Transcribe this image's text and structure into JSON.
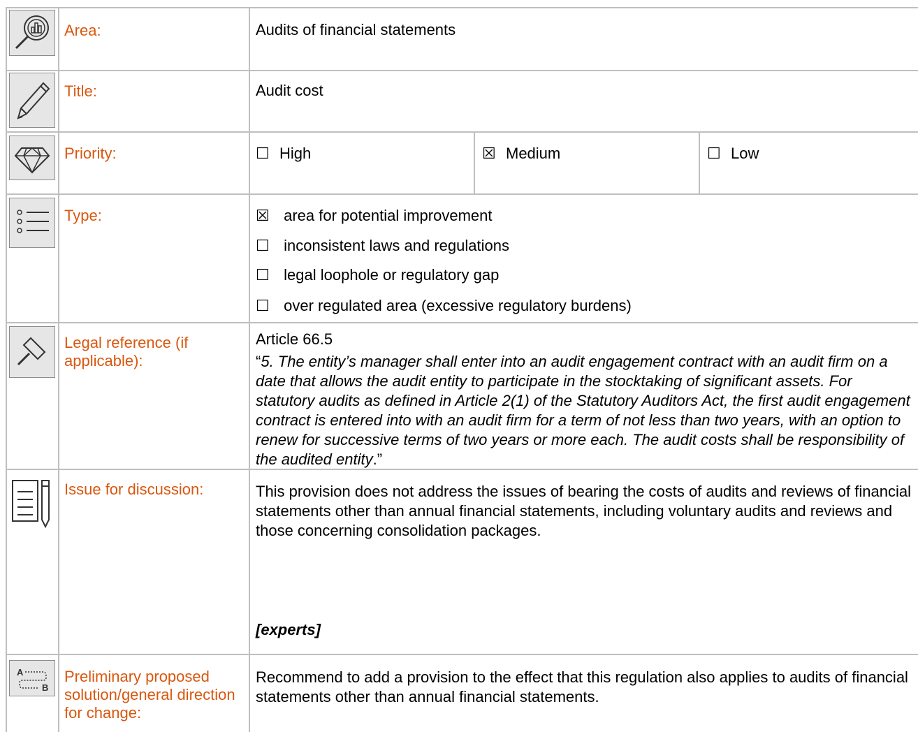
{
  "rows": {
    "area": {
      "label": "Area:",
      "value": "Audits of financial statements",
      "icon": "magnifier-chart-icon"
    },
    "title": {
      "label": "Title:",
      "value": "Audit cost",
      "icon": "pencil-icon"
    },
    "priority": {
      "label": "Priority:",
      "icon": "diamond-icon",
      "options": [
        {
          "mark": "☐",
          "text": "High"
        },
        {
          "mark": "☒",
          "text": "Medium"
        },
        {
          "mark": "☐",
          "text": "Low"
        }
      ]
    },
    "type": {
      "label": "Type:",
      "icon": "list-icon",
      "options": [
        {
          "mark": "☒",
          "text": "area for potential improvement"
        },
        {
          "mark": "☐",
          "text": "inconsistent laws and regulations"
        },
        {
          "mark": "☐",
          "text": "legal loophole or regulatory gap"
        },
        {
          "mark": "☐",
          "text": "over regulated area (excessive regulatory burdens)"
        }
      ]
    },
    "legal": {
      "label": "Legal reference (if applicable):",
      "icon": "gavel-icon",
      "article": "Article 66.5",
      "open_quote": "“",
      "quote": "5. The entity’s manager shall enter into an audit engagement contract with an audit firm on a date that allows the audit entity to participate in the stocktaking of significant assets. For statutory audits as defined in Article 2(1) of the Statutory Auditors Act, the first audit engagement contract is entered into with an audit firm for a term of not less than two years, with an option to renew for successive terms of two years or more each. The audit costs shall be responsibility of the audited entity",
      "close_quote": ".”"
    },
    "issue": {
      "label": "Issue for discussion:",
      "icon": "notepad-pen-icon",
      "text": "This provision does not address the issues of bearing the costs of audits and reviews of financial statements other than annual financial statements, including voluntary audits and reviews and those concerning consolidation packages.",
      "note": "[experts]"
    },
    "solution": {
      "label": "Preliminary proposed solution/general direction for change:",
      "icon": "a-to-b-path-icon",
      "icon_letter_a": "A",
      "icon_letter_b": "B",
      "text": "Recommend to add a provision to the effect that this regulation also applies to audits of financial statements other than annual financial statements."
    }
  }
}
